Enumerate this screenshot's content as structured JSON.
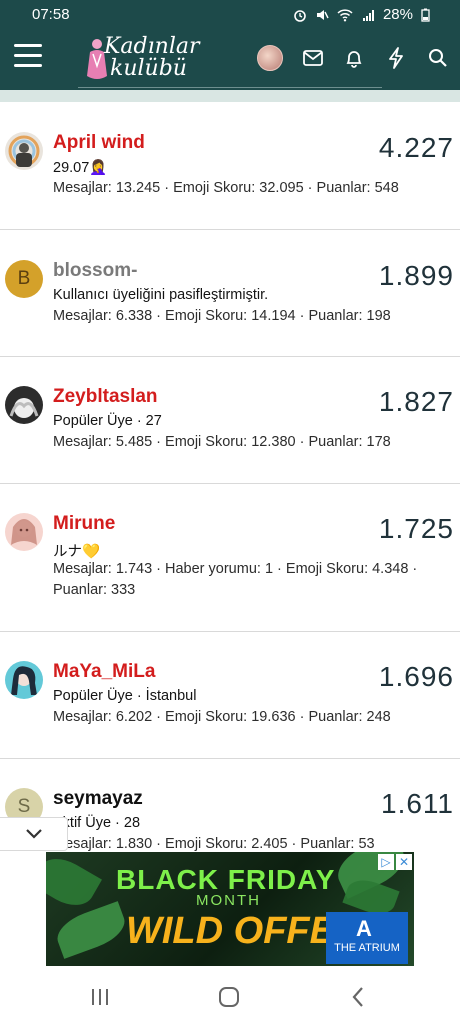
{
  "status_bar": {
    "time": "07:58",
    "battery": "28%"
  },
  "header": {
    "logo_line1": "Kadınlar",
    "logo_line2": "kulübü"
  },
  "members": [
    {
      "name": "April wind",
      "name_color": "#d31d1d",
      "subtitle": "29.07🤦‍♀️",
      "stats": "Mesajlar: 13.245 · Emoji Skoru: 32.095 · Puanlar: 548",
      "score": "4.227"
    },
    {
      "name": "blossom-",
      "name_color": "#7a7a7a",
      "avatar_letter": "B",
      "subtitle": "Kullanıcı üyeliğini pasifleştirmiştir.",
      "stats": "Mesajlar: 6.338 · Emoji Skoru: 14.194 · Puanlar: 198",
      "score": "1.899"
    },
    {
      "name": "Zeybltaslan",
      "name_color": "#d31d1d",
      "subtitle": "Popüler Üye · 27",
      "stats": "Mesajlar: 5.485 · Emoji Skoru: 12.380 · Puanlar: 178",
      "score": "1.827"
    },
    {
      "name": "Mirune",
      "name_color": "#d31d1d",
      "subtitle": "ルナ💛",
      "stats": "Mesajlar: 1.743 · Haber yorumu: 1 · Emoji Skoru: 4.348 · Puanlar: 333",
      "score": "1.725"
    },
    {
      "name": "MaYa_MiLa",
      "name_color": "#d31d1d",
      "subtitle": "Popüler Üye · İstanbul",
      "stats": "Mesajlar: 6.202 · Emoji Skoru: 19.636 · Puanlar: 248",
      "score": "1.696"
    },
    {
      "name": "seymayaz",
      "name_color": "#111111",
      "avatar_letter": "S",
      "subtitle": "Aktif Üye · 28",
      "stats": "Mesajlar: 1.830 · Emoji Skoru: 2.405 · Puanlar: 53",
      "score": "1.611"
    }
  ],
  "ad": {
    "headline": "BLACK FRIDAY",
    "month": "MONTH",
    "offer": "WILD OFFERS",
    "brand": "THE ATRIUM",
    "brand_mark": "A",
    "info_icon": "info-icon",
    "close_icon": "close-icon"
  },
  "icons": {
    "menu": "hamburger-menu-icon",
    "mail": "mail-icon",
    "bell": "bell-icon",
    "bolt": "lightning-icon",
    "search": "search-icon",
    "collapse": "chevron-down-icon",
    "nav_recent": "recent-apps-icon",
    "nav_home": "home-icon",
    "nav_back": "back-icon"
  },
  "colors": {
    "header_bg": "#1d4a4a",
    "name_red": "#d31d1d",
    "score": "#20323a"
  }
}
